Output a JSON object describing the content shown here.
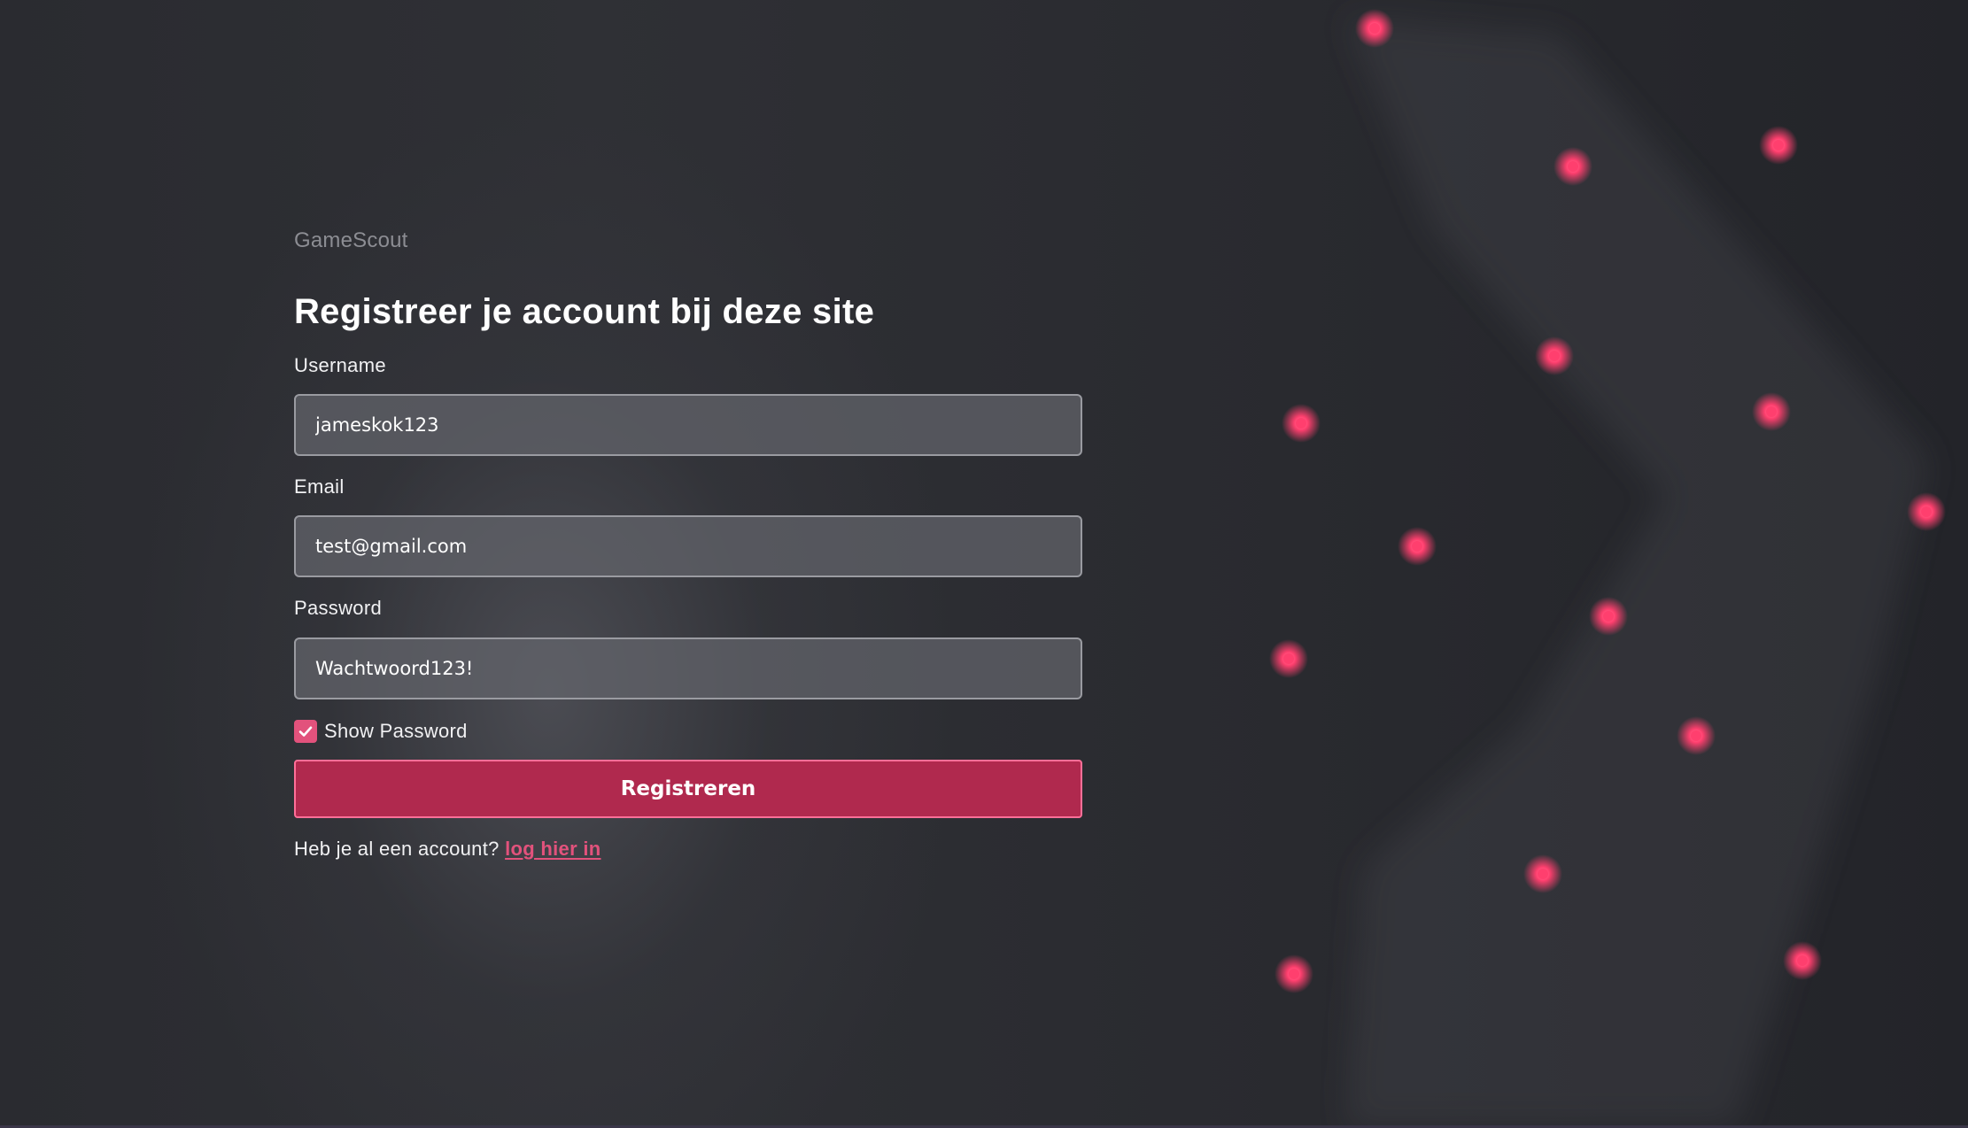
{
  "brand": "GameScout",
  "title": "Registreer je account bij deze site",
  "form": {
    "username": {
      "label": "Username",
      "value": "jameskok123"
    },
    "email": {
      "label": "Email",
      "value": "test@gmail.com"
    },
    "password": {
      "label": "Password",
      "value": "Wachtwoord123!"
    },
    "show_password": {
      "label": "Show Password",
      "checked": true
    },
    "submit_label": "Registreren"
  },
  "footer": {
    "prompt": "Heb je al een account?",
    "login_link": "log hier in"
  },
  "colors": {
    "accent": "#e2527c",
    "button_bg": "#b0294e",
    "background": "#2a2b30",
    "glow_dot": "#ff3f6e"
  }
}
